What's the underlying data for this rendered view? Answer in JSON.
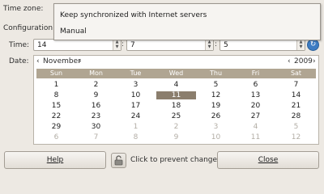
{
  "labels": {
    "time_zone": "Time zone:",
    "configuration": "Configuration:",
    "time": "Time:",
    "date": "Date:"
  },
  "configuration_menu": {
    "options": [
      "Keep synchronized with Internet servers",
      "Manual"
    ]
  },
  "time": {
    "hours": "14",
    "minutes": "7",
    "seconds": "5"
  },
  "calendar": {
    "month": "November",
    "year": "2009",
    "prev_month": "‹",
    "next_month": "›",
    "prev_year": "‹",
    "next_year": "›",
    "weekdays": [
      "Sun",
      "Mon",
      "Tue",
      "Wed",
      "Thu",
      "Fri",
      "Sat"
    ],
    "weeks": [
      [
        "1",
        "2",
        "3",
        "4",
        "5",
        "6",
        "7"
      ],
      [
        "8",
        "9",
        "10",
        "11",
        "12",
        "13",
        "14"
      ],
      [
        "15",
        "16",
        "17",
        "18",
        "19",
        "20",
        "21"
      ],
      [
        "22",
        "23",
        "24",
        "25",
        "26",
        "27",
        "28"
      ],
      [
        "29",
        "30",
        "1",
        "2",
        "3",
        "4",
        "5"
      ],
      [
        "6",
        "7",
        "8",
        "9",
        "10",
        "11",
        "12"
      ]
    ],
    "selected_day": "11"
  },
  "footer": {
    "help": "Help",
    "lock_text": "Click to prevent changes",
    "close": "Close"
  },
  "icons": {
    "refresh": "refresh-icon",
    "lock": "lock-icon"
  }
}
